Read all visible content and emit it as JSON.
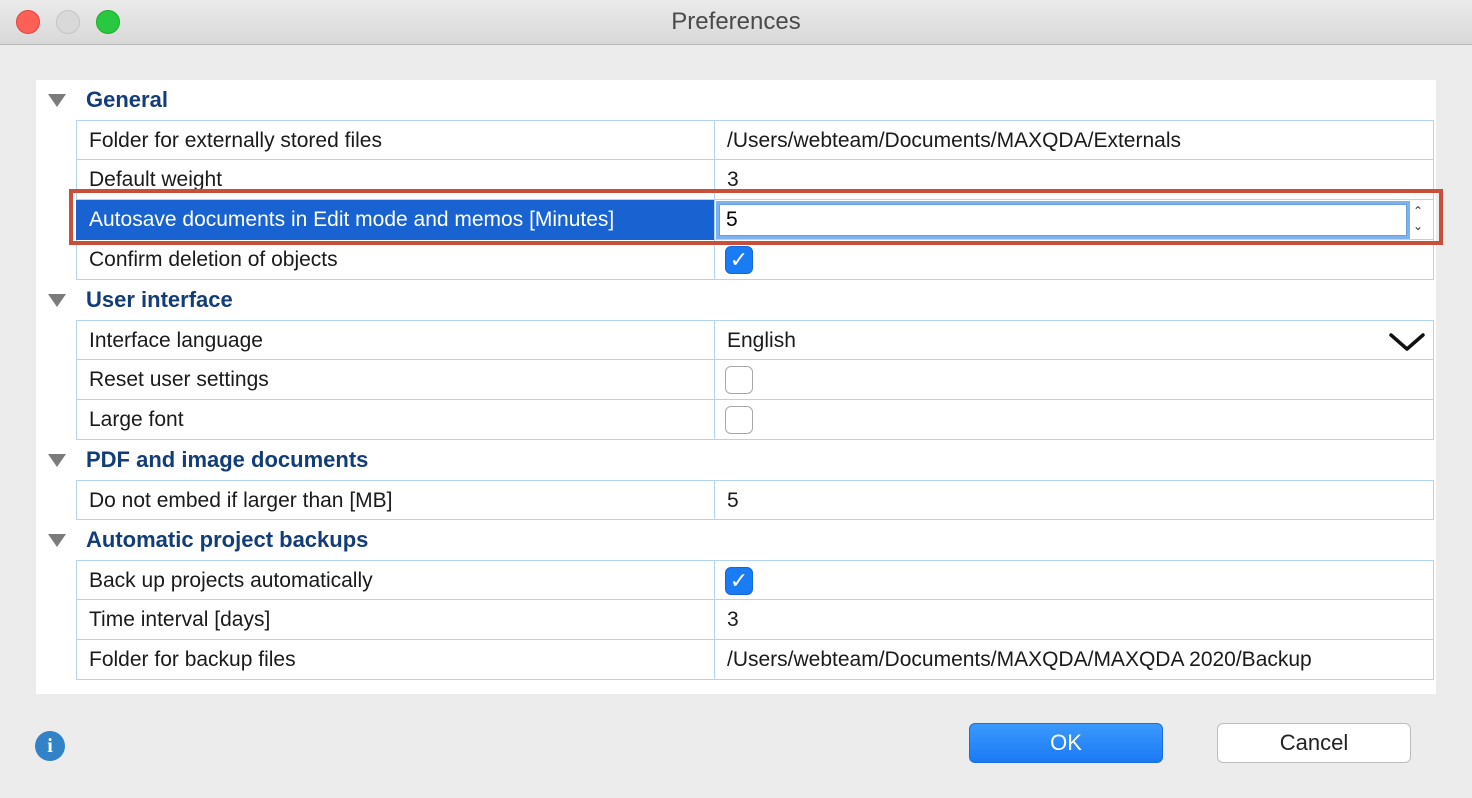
{
  "window": {
    "title": "Preferences"
  },
  "sections": {
    "general": "General",
    "user_interface": "User interface",
    "pdf": "PDF and image documents",
    "backups": "Automatic project backups"
  },
  "rows": {
    "externals_label": "Folder for externally stored files",
    "externals_value": "/Users/webteam/Documents/MAXQDA/Externals",
    "weight_label": "Default weight",
    "weight_value": "3",
    "autosave_label": "Autosave documents in Edit mode and memos [Minutes]",
    "autosave_value": "5",
    "confirm_label": "Confirm deletion of objects",
    "confirm_checked": true,
    "language_label": "Interface language",
    "language_value": "English",
    "reset_label": "Reset user settings",
    "reset_checked": false,
    "largefont_label": "Large font",
    "largefont_checked": false,
    "embed_label": "Do not embed if larger than [MB]",
    "embed_value": "5",
    "backup_auto_label": "Back up projects automatically",
    "backup_auto_checked": true,
    "interval_label": "Time interval [days]",
    "interval_value": "3",
    "backup_folder_label": "Folder for backup files",
    "backup_folder_value": "/Users/webteam/Documents/MAXQDA/MAXQDA 2020/Backup"
  },
  "buttons": {
    "ok": "OK",
    "cancel": "Cancel"
  },
  "icons": {
    "check": "✓",
    "chevron": "⌵",
    "info": "i",
    "stepper_up": "⌃",
    "stepper_down": "⌄"
  },
  "colors": {
    "selection": "#1862d1",
    "section_text": "#123d79",
    "highlight_border": "#c8503b",
    "primary_button": "#1a7af5"
  }
}
